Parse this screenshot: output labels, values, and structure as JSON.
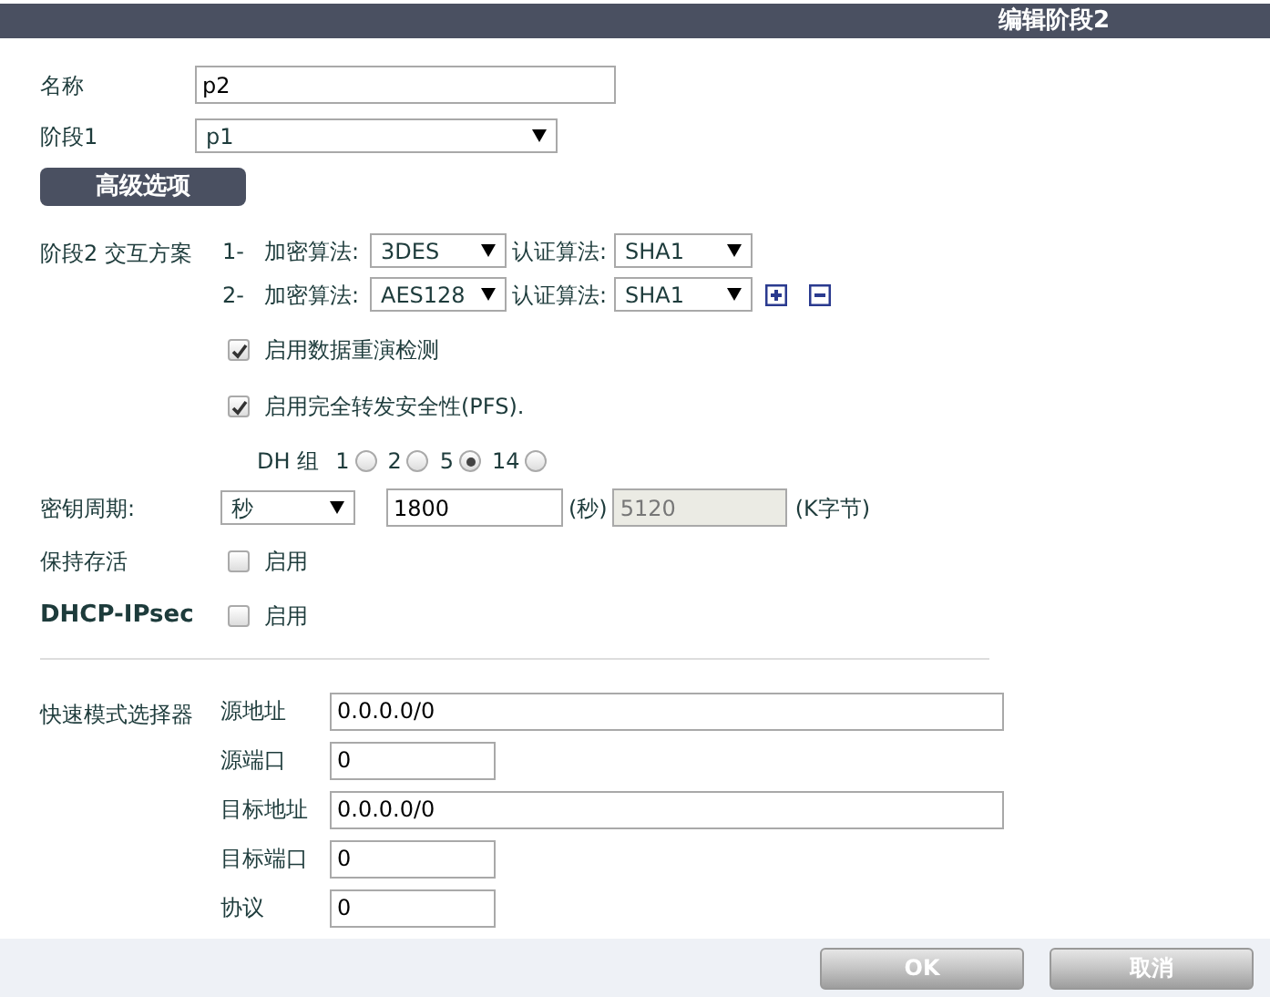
{
  "header": {
    "title": "编辑阶段2"
  },
  "name": {
    "label": "名称",
    "value": "p2"
  },
  "phase1": {
    "label": "阶段1",
    "value": "p1"
  },
  "advanced_button": "高级选项",
  "proposals": {
    "label": "阶段2 交互方案",
    "items": [
      {
        "index": "1-",
        "enc_label": "加密算法:",
        "enc": "3DES",
        "auth_label": "认证算法:",
        "auth": "SHA1"
      },
      {
        "index": "2-",
        "enc_label": "加密算法:",
        "enc": "AES128",
        "auth_label": "认证算法:",
        "auth": "SHA1"
      }
    ]
  },
  "options": [
    {
      "label": "启用数据重演检测",
      "checked": true
    },
    {
      "label": "启用完全转发安全性(PFS).",
      "checked": true
    }
  ],
  "dh_group": {
    "label": "DH 组",
    "options": [
      {
        "label": "1",
        "selected": false
      },
      {
        "label": "2",
        "selected": false
      },
      {
        "label": "5",
        "selected": true
      },
      {
        "label": "14",
        "selected": false
      }
    ]
  },
  "key_lifetime": {
    "label": "密钥周期:",
    "unit": "秒",
    "seconds": "1800",
    "seconds_unit": "(秒)",
    "kbytes": "5120",
    "kbytes_disabled": true,
    "kbytes_unit": "(K字节)"
  },
  "keepalive": {
    "label": "保持存活",
    "option": "启用",
    "checked": false
  },
  "dhcp_ipsec": {
    "label": "DHCP-IPsec",
    "option": "启用",
    "checked": false
  },
  "selectors": {
    "label": "快速模式选择器",
    "fields": [
      {
        "label": "源地址",
        "value": "0.0.0.0/0",
        "kind": "address"
      },
      {
        "label": "源端口",
        "value": "0",
        "kind": "short"
      },
      {
        "label": "目标地址",
        "value": "0.0.0.0/0",
        "kind": "address"
      },
      {
        "label": "目标端口",
        "value": "0",
        "kind": "short"
      },
      {
        "label": "协议",
        "value": "0",
        "kind": "short"
      }
    ]
  },
  "buttons": [
    {
      "label": "OK"
    },
    {
      "label": "取消"
    }
  ]
}
